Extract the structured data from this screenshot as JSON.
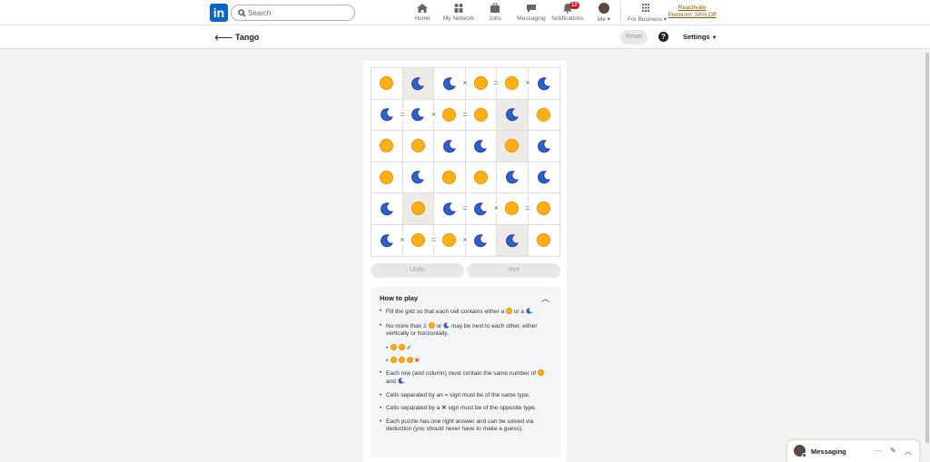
{
  "nav": {
    "logo": "in",
    "search_placeholder": "Search",
    "items": [
      {
        "label": "Home",
        "icon": "home-icon"
      },
      {
        "label": "My Network",
        "icon": "network-icon"
      },
      {
        "label": "Jobs",
        "icon": "jobs-icon"
      },
      {
        "label": "Messaging",
        "icon": "messaging-icon"
      },
      {
        "label": "Notifications",
        "icon": "bell-icon",
        "badge": "12"
      },
      {
        "label": "Me",
        "icon": "avatar"
      },
      {
        "label": "For Business",
        "icon": "grid-icon"
      }
    ],
    "premium": "Reactivate Premium: 50% Off"
  },
  "subheader": {
    "title": "Tango",
    "reset": "Reset",
    "help": "?",
    "settings": "Settings"
  },
  "puzzle": {
    "grid": [
      [
        "sun",
        "moon",
        "moon",
        "sun",
        "sun",
        "moon"
      ],
      [
        "moon",
        "moon",
        "sun",
        "sun",
        "moon",
        "sun"
      ],
      [
        "sun",
        "sun",
        "moon",
        "moon",
        "sun",
        "moon"
      ],
      [
        "sun",
        "moon",
        "sun",
        "sun",
        "moon",
        "moon"
      ],
      [
        "moon",
        "sun",
        "moon",
        "moon",
        "sun",
        "sun"
      ],
      [
        "moon",
        "sun",
        "sun",
        "moon",
        "moon",
        "sun"
      ]
    ],
    "locked": [
      [
        0,
        1
      ],
      [
        1,
        4
      ],
      [
        2,
        4
      ],
      [
        4,
        1
      ],
      [
        5,
        4
      ]
    ],
    "constraints": [
      {
        "r": 0,
        "c": 2,
        "dir": "right",
        "type": "×"
      },
      {
        "r": 0,
        "c": 3,
        "dir": "right",
        "type": "="
      },
      {
        "r": 0,
        "c": 4,
        "dir": "right",
        "type": "×"
      },
      {
        "r": 1,
        "c": 0,
        "dir": "right",
        "type": "="
      },
      {
        "r": 1,
        "c": 1,
        "dir": "right",
        "type": "×"
      },
      {
        "r": 1,
        "c": 2,
        "dir": "right",
        "type": "="
      },
      {
        "r": 4,
        "c": 2,
        "dir": "right",
        "type": "="
      },
      {
        "r": 4,
        "c": 3,
        "dir": "right",
        "type": "×"
      },
      {
        "r": 4,
        "c": 4,
        "dir": "right",
        "type": "="
      },
      {
        "r": 5,
        "c": 0,
        "dir": "right",
        "type": "×"
      },
      {
        "r": 5,
        "c": 1,
        "dir": "right",
        "type": "="
      },
      {
        "r": 5,
        "c": 2,
        "dir": "right",
        "type": "×"
      }
    ]
  },
  "buttons": {
    "undo": "Undo",
    "hint": "Hint"
  },
  "howto": {
    "title": "How to play",
    "r1a": "Fill the grid so that each cell contains either a",
    "r1b": "or a",
    "r1c": ".",
    "r2a": "No more than 2",
    "r2b": "or",
    "r2c": "may be next to each other, either vertically or horizontally.",
    "ex_ok": "✓",
    "ex_bad": "✕",
    "r3a": "Each row (and column) must contain the same number of",
    "r3b": "and",
    "r3c": ".",
    "r4": "Cells separated by an = sign must be of the same type.",
    "r5a": "Cells separated by a",
    "r5x": "✕",
    "r5b": "sign must be of the opposite type.",
    "r6": "Each puzzle has one right answer and can be solved via deduction (you should never have to make a guess)."
  },
  "messaging": {
    "title": "Messaging"
  }
}
